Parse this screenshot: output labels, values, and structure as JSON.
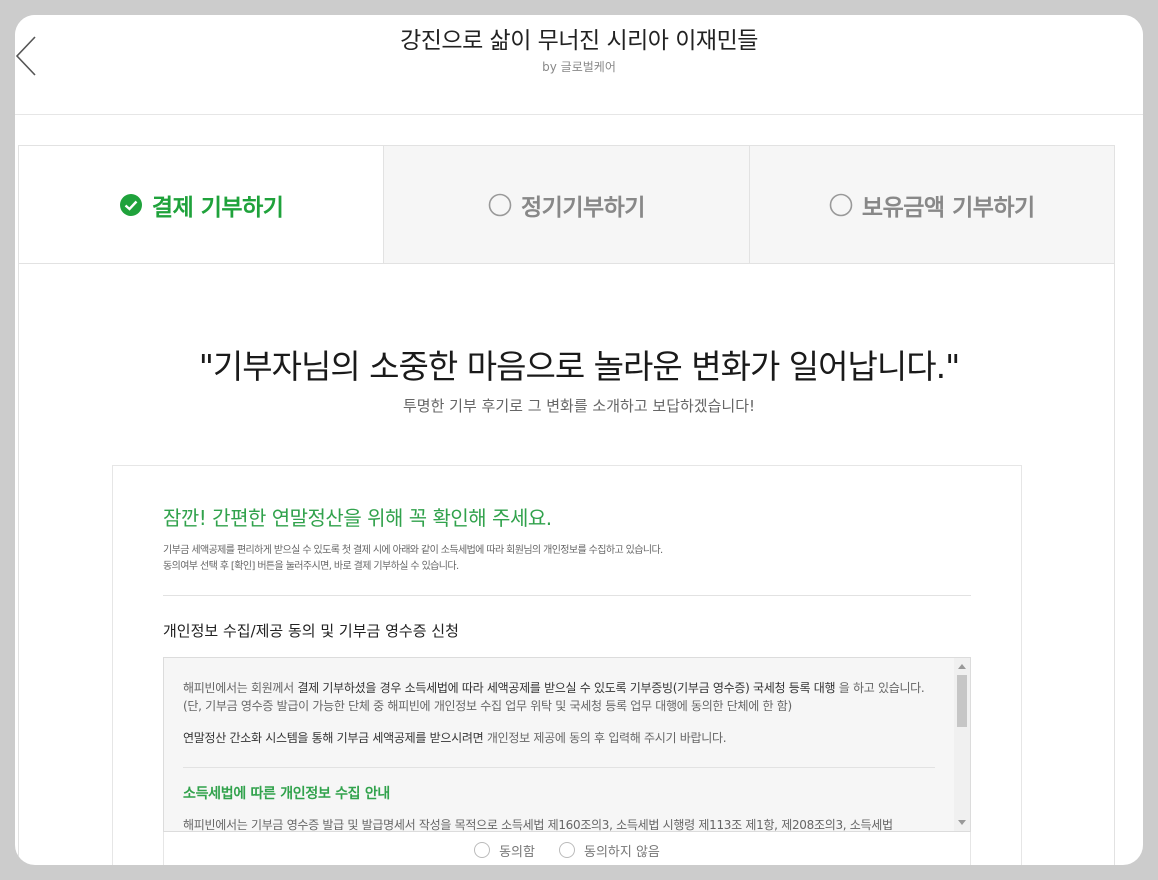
{
  "header": {
    "title": "강진으로 삶이 무너진 시리아 이재민들",
    "subtitle": "by 글로벌케어"
  },
  "tabs": [
    {
      "label": "결제 기부하기",
      "selected": true
    },
    {
      "label": "정기기부하기",
      "selected": false
    },
    {
      "label": "보유금액 기부하기",
      "selected": false
    }
  ],
  "main": {
    "quote": "\"기부자님의 소중한 마음으로 놀라운 변화가 일어납니다.\"",
    "quote_sub": "투명한 기부 후기로 그 변화를 소개하고 보답하겠습니다!"
  },
  "notice": {
    "title": "잠깐! 간편한 연말정산을 위해 꼭 확인해 주세요.",
    "desc_line1": "기부금 세액공제를 편리하게 받으실 수 있도록 첫 결제 시에 아래와 같이 소득세법에 따라 회원님의 개인정보를 수집하고 있습니다.",
    "desc_line2": "동의여부 선택 후 [확인] 버튼을 눌러주시면, 바로 결제 기부하실 수 있습니다."
  },
  "consent": {
    "section_title": "개인정보 수집/제공 동의 및 기부금 영수증 신청",
    "p1_a": "해피빈에서는 회원께서 ",
    "p1_b": "결제 기부하셨을 경우 소득세법에 따라 세액공제를 받으실 수 있도록 기부증빙(기부금 영수증) 국세청 등록 대행",
    "p1_c": " 을 하고 있습니다. (단, 기부금 영수증 발급이 가능한 단체 중 해피빈에 개인정보 수집 업무 위탁 및 국세청 등록 업무 대행에 동의한 단체에 한 함)",
    "p2_a": "연말정산 간소화 시스템을 통해 기부금 세액공제를 받으시려면",
    "p2_b": " 개인정보 제공에 동의 후 입력해 주시기 바랍니다.",
    "green_heading": "소득세법에 따른 개인정보 수집 안내",
    "cut_line": "해피빈에서는 기부금 영수증 발급 및 발급명세서 작성을 목적으로 소득세법 제160조의3, 소득세법 시행령 제113조 제1항, 제208조의3, 소득세법",
    "agree_label": "동의함",
    "disagree_label": "동의하지 않음"
  },
  "colors": {
    "accent_green": "#1fa23b",
    "overlay_gray": "#cccccc"
  },
  "icons": {
    "back": "chevron-left-icon",
    "selected": "check-circle-icon",
    "unselected": "radio-empty-icon"
  }
}
